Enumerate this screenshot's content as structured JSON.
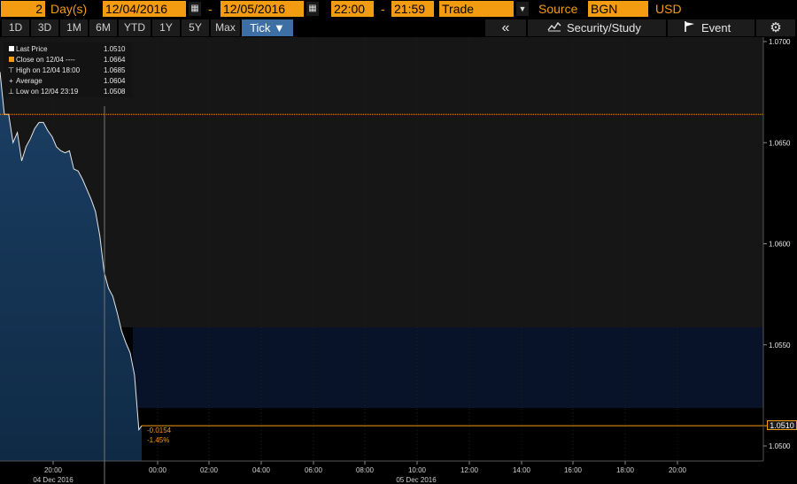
{
  "toolbar": {
    "period_count": "2",
    "period_unit": "Day(s)",
    "start_date": "12/04/2016",
    "end_date": "12/05/2016",
    "date_sep": "-",
    "start_time": "22:00",
    "time_sep": "-",
    "end_time": "21:59",
    "market_field": "Trade",
    "source_label": "Source",
    "source_value": "BGN",
    "currency": "USD"
  },
  "range_tabs": [
    "1D",
    "3D",
    "1M",
    "6M",
    "YTD",
    "1Y",
    "5Y",
    "Max"
  ],
  "tick_tab": "Tick ▼",
  "tools": {
    "back_label": "«",
    "security_study_label": "Security/Study",
    "event_label": "Event",
    "settings_icon": "gear-icon"
  },
  "legend": [
    {
      "label": "Last Price",
      "value": "1.0510",
      "icon": "last-price-swatch"
    },
    {
      "label": "Close on 12/04 ----",
      "value": "1.0664",
      "icon": "close-swatch"
    },
    {
      "label": "High on 12/04 18:00",
      "value": "1.0685",
      "icon": "high-marker-icon"
    },
    {
      "label": "Average",
      "value": "1.0604",
      "icon": "average-marker-icon"
    },
    {
      "label": "Low on 12/04 23:19",
      "value": "1.0508",
      "icon": "low-marker-icon"
    }
  ],
  "change": {
    "abs": "-0.0154",
    "pct": "-1.45%"
  },
  "last_price_tag": "1.0510",
  "colors": {
    "accent": "#f39c12",
    "area": "#12304f",
    "active_tab": "#3d6fa5"
  },
  "chart_data": {
    "type": "area",
    "title": "",
    "xlabel": "",
    "ylabel": "",
    "ylim": [
      1.049,
      1.0702
    ],
    "y_ticks": [
      "1.0700",
      "1.0650",
      "1.0600",
      "1.0550",
      "1.0500"
    ],
    "x_ticks": [
      "20:00",
      "00:00",
      "02:00",
      "04:00",
      "06:00",
      "08:00",
      "10:00",
      "12:00",
      "14:00",
      "16:00",
      "18:00",
      "20:00"
    ],
    "date_labels": [
      "04 Dec 2016",
      "05 Dec 2016"
    ],
    "reference_lines": [
      {
        "name": "Close on 12/04",
        "value": 1.0664
      }
    ],
    "series": [
      {
        "name": "Last Price",
        "x": [
          "12/04 18:00",
          "12/04 18:10",
          "12/04 18:20",
          "12/04 18:30",
          "12/04 18:40",
          "12/04 18:50",
          "12/04 19:00",
          "12/04 19:10",
          "12/04 19:20",
          "12/04 19:30",
          "12/04 19:40",
          "12/04 19:50",
          "12/04 20:00",
          "12/04 20:10",
          "12/04 20:20",
          "12/04 20:30",
          "12/04 20:40",
          "12/04 20:50",
          "12/04 21:00",
          "12/04 21:10",
          "12/04 21:20",
          "12/04 21:30",
          "12/04 21:40",
          "12/04 21:50",
          "12/04 22:00",
          "12/04 22:10",
          "12/04 22:20",
          "12/04 22:30",
          "12/04 22:40",
          "12/04 22:50",
          "12/04 23:00",
          "12/04 23:10",
          "12/04 23:19",
          "12/04 23:30"
        ],
        "values": [
          1.0685,
          1.0664,
          1.0664,
          1.065,
          1.0655,
          1.0641,
          1.0648,
          1.0652,
          1.0657,
          1.066,
          1.066,
          1.0656,
          1.0653,
          1.0648,
          1.0646,
          1.0645,
          1.0646,
          1.0637,
          1.0636,
          1.0632,
          1.0627,
          1.0622,
          1.0616,
          1.0604,
          1.0586,
          1.0578,
          1.0574,
          1.0566,
          1.0557,
          1.0551,
          1.0546,
          1.0535,
          1.0508,
          1.051
        ]
      }
    ]
  }
}
